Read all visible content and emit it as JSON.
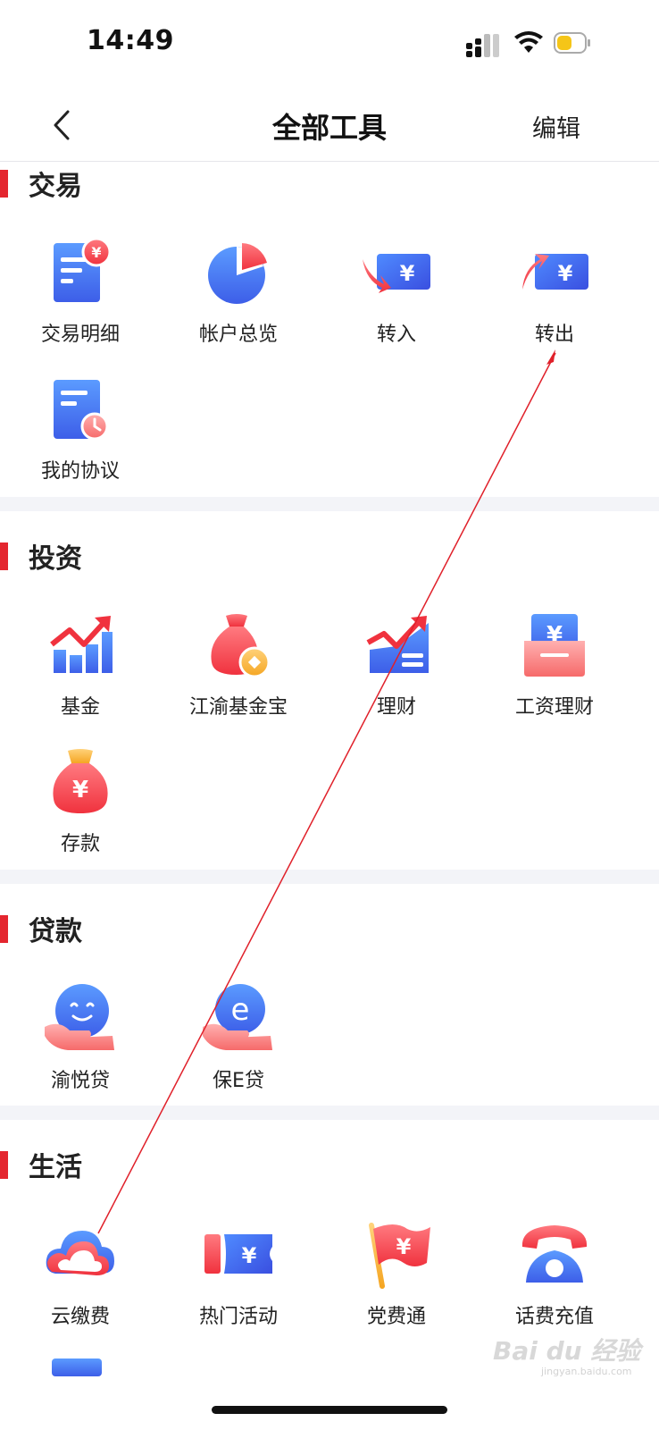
{
  "status": {
    "time": "14:49"
  },
  "nav": {
    "title": "全部工具",
    "edit": "编辑"
  },
  "sections": [
    {
      "title": "交易",
      "tools": [
        "交易明细",
        "帐户总览",
        "转入",
        "转出",
        "我的协议"
      ]
    },
    {
      "title": "投资",
      "tools": [
        "基金",
        "江渝基金宝",
        "理财",
        "工资理财",
        "存款"
      ]
    },
    {
      "title": "贷款",
      "tools": [
        "渝悦贷",
        "保E贷"
      ]
    },
    {
      "title": "生活",
      "tools": [
        "云缴费",
        "热门活动",
        "党费通",
        "话费充值"
      ]
    }
  ],
  "icons": {
    "yen": "¥",
    "e": "e"
  },
  "watermark": {
    "main": "Bai du 经验",
    "sub": "jingyan.baidu.com"
  },
  "colors": {
    "accent": "#e4262f",
    "blue": "#3e6ef0",
    "red": "#f2505a",
    "gap": "#f3f4f8"
  }
}
